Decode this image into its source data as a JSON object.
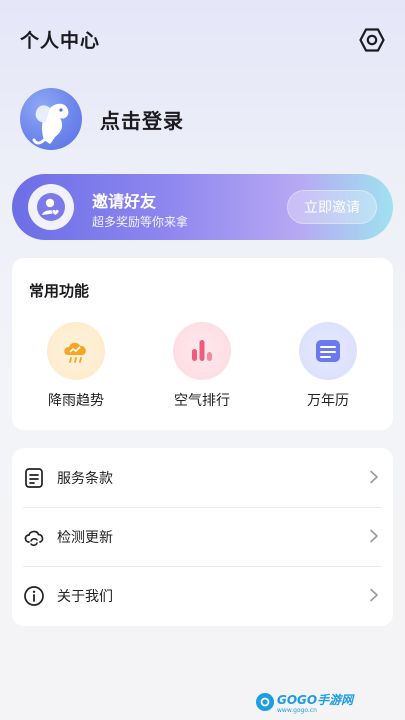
{
  "header": {
    "title": "个人中心",
    "settings_icon": "gear-hexagon-icon"
  },
  "profile": {
    "avatar_icon": "elephant-avatar-icon",
    "login_label": "点击登录"
  },
  "invite": {
    "title": "邀请好友",
    "subtitle": "超多奖励等你来拿",
    "button_label": "立即邀请",
    "icon": "user-heart-icon",
    "gradient_colors": [
      "#6c6ee6",
      "#8d86ef",
      "#b7a8f3",
      "#9fe2f0"
    ]
  },
  "functions": {
    "title": "常用功能",
    "items": [
      {
        "label": "降雨趋势",
        "icon": "rain-cloud-icon",
        "color": "#f5a623"
      },
      {
        "label": "空气排行",
        "icon": "bar-ranking-icon",
        "color": "#ef5b7a"
      },
      {
        "label": "万年历",
        "icon": "calendar-doc-icon",
        "color": "#6b78ee"
      }
    ]
  },
  "menu": {
    "items": [
      {
        "label": "服务条款",
        "icon": "document-list-icon"
      },
      {
        "label": "检测更新",
        "icon": "cloud-sync-icon"
      },
      {
        "label": "关于我们",
        "icon": "info-circle-icon"
      }
    ]
  },
  "watermark": {
    "text": "GOGO手游网",
    "url_text": "www.gogo.cn"
  }
}
